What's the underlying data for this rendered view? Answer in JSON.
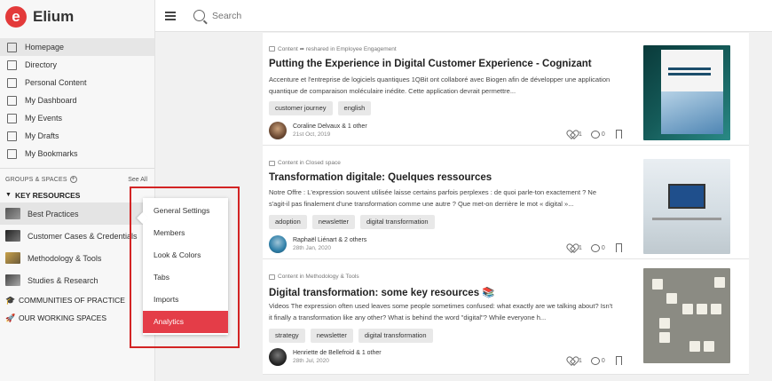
{
  "app": {
    "name": "Elium",
    "logo_letter": "e",
    "accent": "#e33a3a"
  },
  "search": {
    "placeholder": "Search"
  },
  "nav": [
    {
      "label": "Homepage"
    },
    {
      "label": "Directory"
    },
    {
      "label": "Personal Content"
    },
    {
      "label": "My Dashboard"
    },
    {
      "label": "My Events"
    },
    {
      "label": "My Drafts"
    },
    {
      "label": "My Bookmarks"
    }
  ],
  "groups": {
    "title": "GROUPS & SPACES",
    "see_all": "See All"
  },
  "key_resources": {
    "label": "KEY RESOURCES"
  },
  "spaces": [
    {
      "label": "Best Practices"
    },
    {
      "label": "Customer Cases & Credentials"
    },
    {
      "label": "Methodology & Tools"
    },
    {
      "label": "Studies & Research"
    }
  ],
  "group_links": [
    {
      "label": "COMMUNITIES OF PRACTICE"
    },
    {
      "label": "OUR WORKING SPACES"
    }
  ],
  "context_menu": [
    {
      "label": "General Settings"
    },
    {
      "label": "Members"
    },
    {
      "label": "Look & Colors"
    },
    {
      "label": "Tabs"
    },
    {
      "label": "Imports"
    },
    {
      "label": "Analytics"
    }
  ],
  "posts": [
    {
      "meta": "Content ➦ reshared in Employee Engagement",
      "title": "Putting the Experience in Digital Customer Experience - Cognizant",
      "excerpt": "Accenture et l'entreprise de logiciels quantiques 1QBit ont collaboré avec Biogen afin de développer une application quantique de comparaison moléculaire inédite. Cette application devrait permettre...",
      "tags": [
        "customer journey",
        "english"
      ],
      "author": "Coraline Delvaux & 1 other",
      "date": "21st Oct, 2019",
      "likes": "1",
      "comments": "0"
    },
    {
      "meta": "Content in Closed space",
      "title": "Transformation digitale: Quelques ressources",
      "excerpt": "Notre Offre : L'expression souvent utilisée laisse certains parfois perplexes : de quoi parle-ton exactement ? Ne s'agit-il pas finalement d'une transformation comme une autre ? Que met-on derrière le mot « digital »...",
      "tags": [
        "adoption",
        "newsletter",
        "digital transformation"
      ],
      "author": "Raphaël Liénart & 2 others",
      "date": "28th Jan, 2020",
      "likes": "1",
      "comments": "0"
    },
    {
      "meta": "Content in Methodology & Tools",
      "title": "Digital transformation: some key resources 📚",
      "excerpt": "Videos The expression often used leaves some people sometimes confused: what exactly are we talking about? Isn't it finally a transformation like any other? What is behind the word \"digital\"? While everyone h...",
      "tags": [
        "strategy",
        "newsletter",
        "digital transformation"
      ],
      "author": "Henriette de Bellefroid & 1 other",
      "date": "28th Jul, 2020",
      "likes": "1",
      "comments": "0"
    }
  ]
}
